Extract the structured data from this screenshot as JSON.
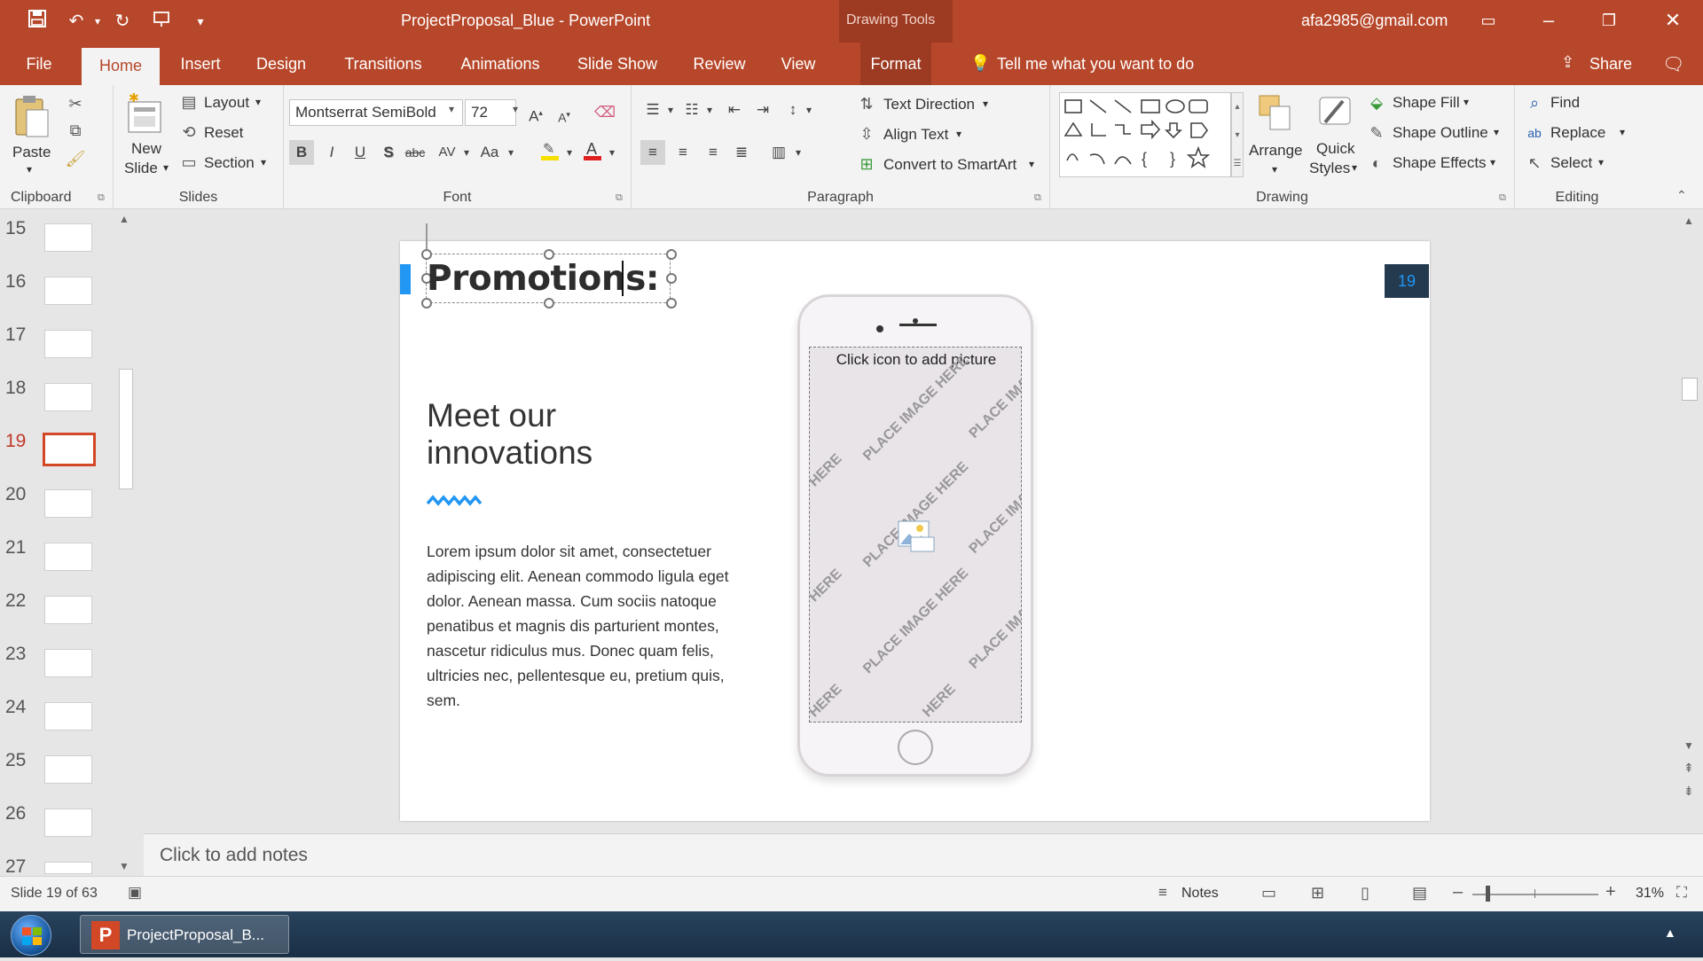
{
  "titlebar": {
    "title": "ProjectProposal_Blue  -  PowerPoint",
    "context": "Drawing Tools",
    "account": "afa2985@gmail.com"
  },
  "tabs": [
    "File",
    "Home",
    "Insert",
    "Design",
    "Transitions",
    "Animations",
    "Slide Show",
    "Review",
    "View",
    "Format"
  ],
  "tell_me": "Tell me what you want to do",
  "share": "Share",
  "ribbon": {
    "clipboard": {
      "label": "Clipboard",
      "paste": "Paste"
    },
    "slides": {
      "label": "Slides",
      "new_slide_1": "New",
      "new_slide_2": "Slide",
      "layout": "Layout",
      "reset": "Reset",
      "section": "Section"
    },
    "font": {
      "label": "Font",
      "family": "Montserrat SemiBold",
      "size": "72",
      "bold": "B",
      "italic": "I",
      "underline": "U",
      "shadow": "S",
      "strike": "abc",
      "spacing": "AV",
      "case": "Aa"
    },
    "paragraph": {
      "label": "Paragraph",
      "text_direction": "Text Direction",
      "align_text": "Align Text",
      "smartart": "Convert to SmartArt"
    },
    "drawing": {
      "label": "Drawing",
      "arrange": "Arrange",
      "quick_1": "Quick",
      "quick_2": "Styles",
      "shape_fill": "Shape Fill",
      "shape_outline": "Shape Outline",
      "shape_effects": "Shape Effects"
    },
    "editing": {
      "label": "Editing",
      "find": "Find",
      "replace": "Replace",
      "select": "Select"
    }
  },
  "thumbnails": [
    "15",
    "16",
    "17",
    "18",
    "19",
    "20",
    "21",
    "22",
    "23",
    "24",
    "25",
    "26",
    "27"
  ],
  "selected_slide": "19",
  "slide": {
    "title": "Promotions:",
    "number": "19",
    "heading_1": "Meet our",
    "heading_2": "innovations",
    "body": "Lorem ipsum dolor sit amet, consectetuer adipiscing elit. Aenean commodo ligula eget dolor. Aenean massa. Cum sociis natoque penatibus et magnis dis parturient montes, nascetur ridiculus mus. Donec quam felis, ultricies nec, pellentesque eu, pretium quis, sem.",
    "placeholder_hint": "Click icon to add picture",
    "placeholder_a": "PLACE IMAGE HERE",
    "placeholder_b": "PLACE IMA",
    "placeholder_c": "HERE"
  },
  "notes_placeholder": "Click to add notes",
  "status": {
    "slide_info": "Slide 19 of 63",
    "notes": "Notes",
    "zoom": "31%"
  },
  "taskbar": {
    "app": "ProjectProposal_B..."
  },
  "colors": {
    "brand": "#b7472a",
    "accent": "#2196f3",
    "badge": "#243a4f"
  }
}
